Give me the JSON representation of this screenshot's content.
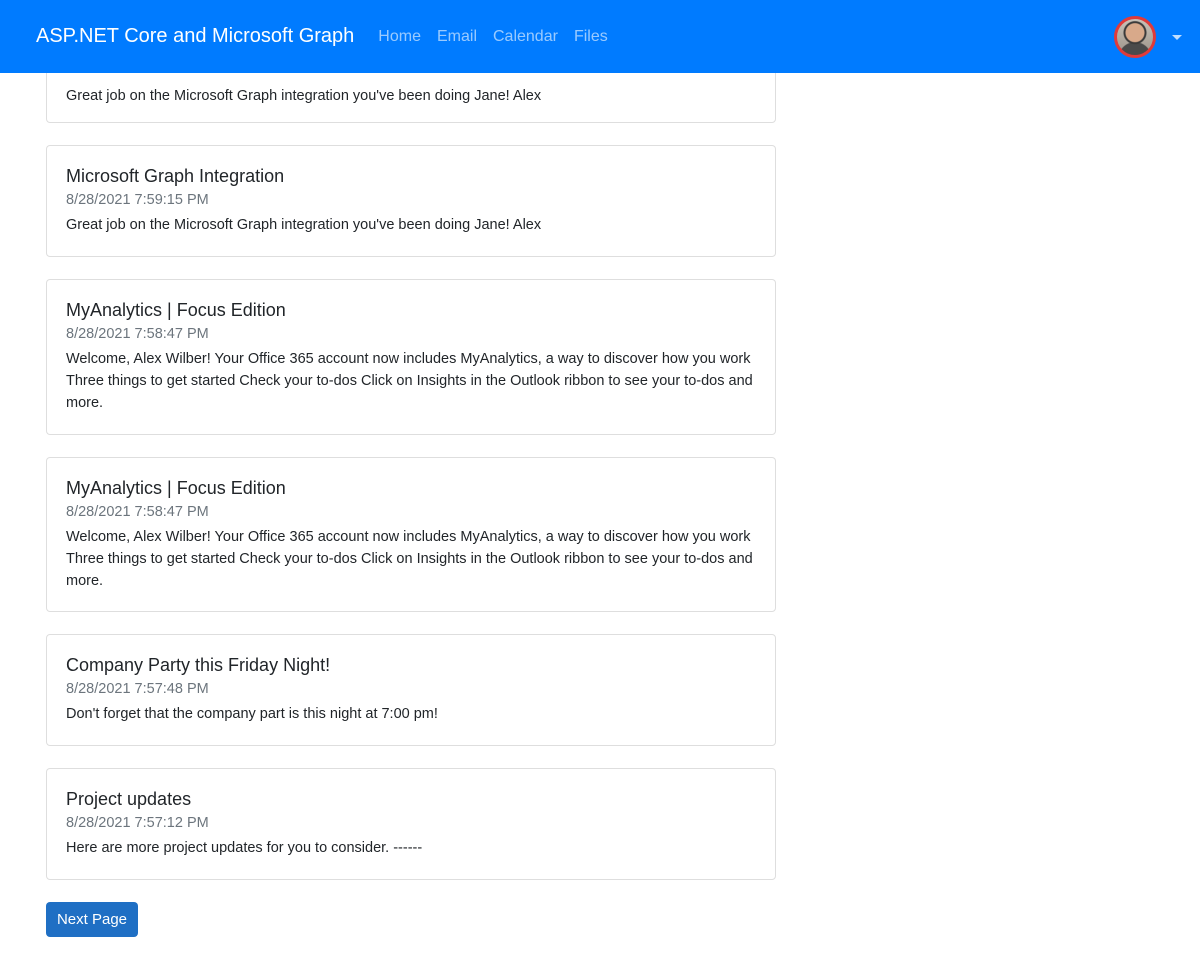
{
  "navbar": {
    "brand": "ASP.NET Core and Microsoft Graph",
    "links": [
      "Home",
      "Email",
      "Calendar",
      "Files"
    ]
  },
  "messages": [
    {
      "subject": "",
      "date": "",
      "preview": "Great job on the Microsoft Graph integration you've been doing Jane! Alex"
    },
    {
      "subject": "Microsoft Graph Integration",
      "date": "8/28/2021 7:59:15 PM",
      "preview": "Great job on the Microsoft Graph integration you've been doing Jane! Alex"
    },
    {
      "subject": "MyAnalytics | Focus Edition",
      "date": "8/28/2021 7:58:47 PM",
      "preview": "Welcome, Alex Wilber! Your Office 365 account now includes MyAnalytics, a way to discover how you work Three things to get started Check your to-dos Click on Insights in the Outlook ribbon to see your to-dos and more."
    },
    {
      "subject": "MyAnalytics | Focus Edition",
      "date": "8/28/2021 7:58:47 PM",
      "preview": "Welcome, Alex Wilber! Your Office 365 account now includes MyAnalytics, a way to discover how you work Three things to get started Check your to-dos Click on Insights in the Outlook ribbon to see your to-dos and more."
    },
    {
      "subject": "Company Party this Friday Night!",
      "date": "8/28/2021 7:57:48 PM",
      "preview": "Don't forget that the company part is this night at 7:00 pm!"
    },
    {
      "subject": "Project updates",
      "date": "8/28/2021 7:57:12 PM",
      "preview": "Here are more project updates for you to consider. ------"
    }
  ],
  "pagination": {
    "next_label": "Next Page"
  },
  "colors": {
    "navbar": "#007bff",
    "button": "#1f6fc4",
    "muted": "#6c757d"
  }
}
